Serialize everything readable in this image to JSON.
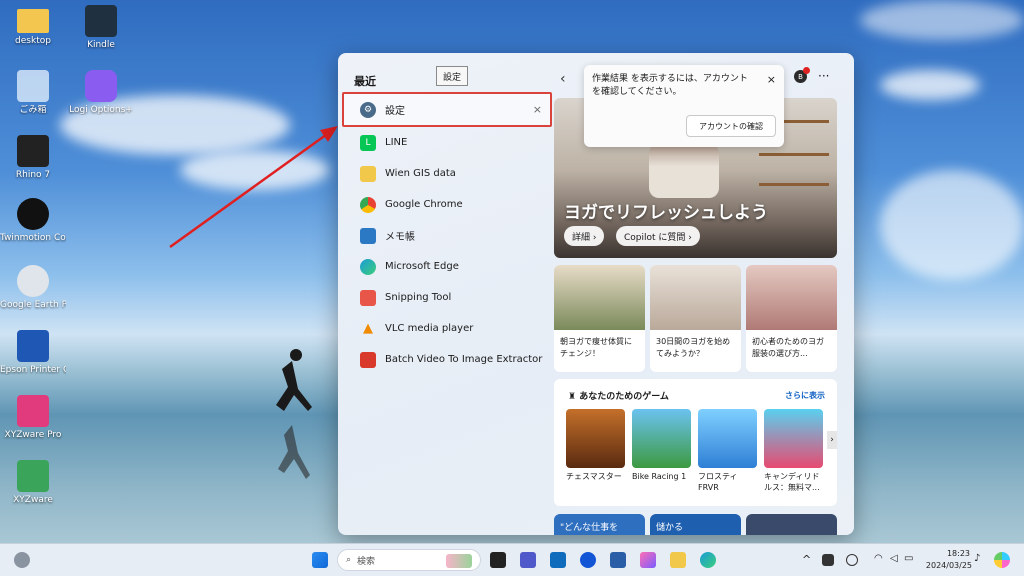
{
  "desktop": {
    "icons": [
      {
        "label": "desktop"
      },
      {
        "label": "Kindle"
      },
      {
        "label": "ごみ箱"
      },
      {
        "label": "Logi Options+"
      },
      {
        "label": "Rhino 7"
      },
      {
        "label": "Twinmotion Community ..."
      },
      {
        "label": "Google Earth Pro"
      },
      {
        "label": "Epson Printer Connection..."
      },
      {
        "label": "XYZware Pro"
      },
      {
        "label": "XYZware"
      }
    ]
  },
  "panel": {
    "recent_title": "最近",
    "tooltip": "設定",
    "recent_items": [
      {
        "label": "設定",
        "icon": "gear-icon",
        "color": "#4a6a8a"
      },
      {
        "label": "LINE",
        "icon": "line-icon",
        "color": "#06c755"
      },
      {
        "label": "Wien GIS data",
        "icon": "folder-icon",
        "color": "#f2c84b"
      },
      {
        "label": "Google Chrome",
        "icon": "chrome-icon",
        "color": "#e94235"
      },
      {
        "label": "メモ帳",
        "icon": "notepad-icon",
        "color": "#2b78c5"
      },
      {
        "label": "Microsoft Edge",
        "icon": "edge-icon",
        "color": "#1a9bd7"
      },
      {
        "label": "Snipping Tool",
        "icon": "snipping-tool-icon",
        "color": "#e8564a"
      },
      {
        "label": "VLC media player",
        "icon": "vlc-icon",
        "color": "#f08a00"
      },
      {
        "label": "Batch Video To Image Extractor",
        "icon": "extractor-icon",
        "color": "#d8392b"
      }
    ],
    "remove_glyph": "×",
    "notice": {
      "text": "作業結果 を表示するには、アカウントを確認してください。",
      "button": "アカウントの確認",
      "close_glyph": "×"
    },
    "badge_letter": "B",
    "more_glyph": "···",
    "back_glyph": "‹",
    "hero": {
      "title": "ヨガでリフレッシュしよう",
      "chip_details": "詳細 ›",
      "chip_copilot": "Copilot に質問 ›"
    },
    "cards": [
      {
        "text": "朝ヨガで痩せ体質にチェンジ！"
      },
      {
        "text": "30日間のヨガを始めてみようか？"
      },
      {
        "text": "初心者のためのヨガ服装の選び方..."
      }
    ],
    "games": {
      "header": "あなたのためのゲーム",
      "see_more": "さらに表示",
      "items": [
        {
          "name": "チェスマスター"
        },
        {
          "name": "Bike Racing 1"
        },
        {
          "name": "フロスティFRVR"
        },
        {
          "name": "キャンディリドルス：無料マ..."
        }
      ]
    },
    "bottom_cards": [
      {
        "text": "\"どんな仕事を"
      },
      {
        "text": "儲かる"
      }
    ]
  },
  "taskbar": {
    "search_placeholder": "検索",
    "time": "18:23",
    "date": "2024/03/25",
    "tray_up": "^"
  }
}
